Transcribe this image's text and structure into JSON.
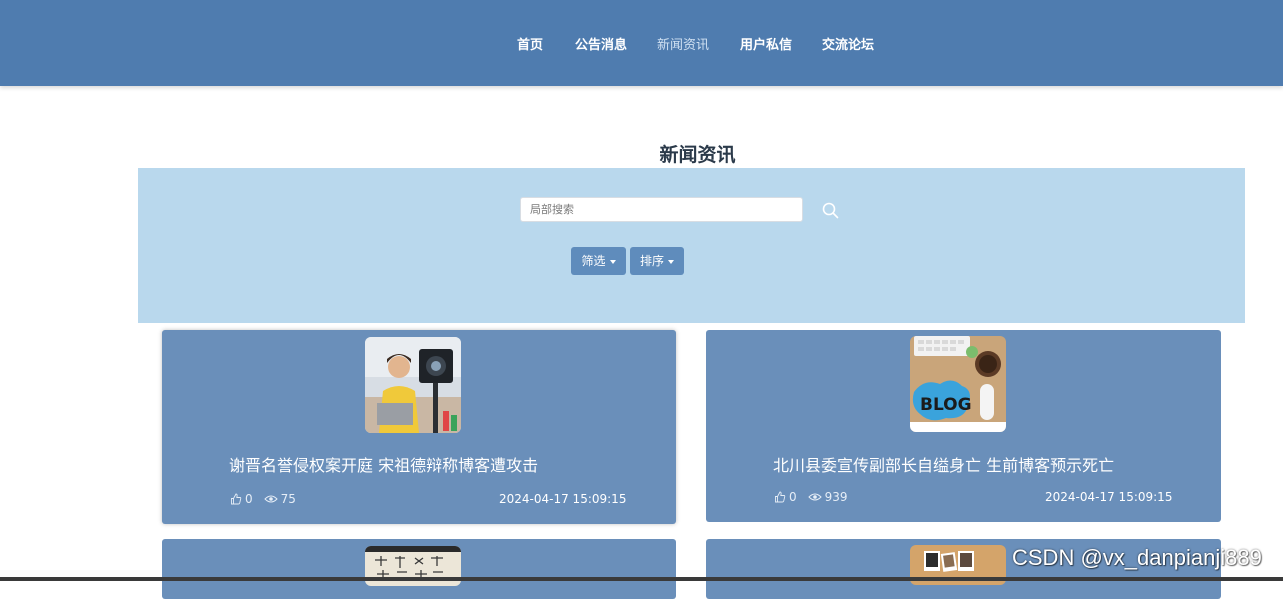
{
  "nav": {
    "items": [
      {
        "label": "首页"
      },
      {
        "label": "公告消息"
      },
      {
        "label": "新闻资讯"
      },
      {
        "label": "用户私信"
      },
      {
        "label": "交流论坛"
      }
    ],
    "active_index": 2
  },
  "page": {
    "title": "新闻资讯"
  },
  "search": {
    "placeholder": "局部搜索",
    "icon": "search-icon"
  },
  "filters": {
    "filter_label": "筛选",
    "sort_label": "排序"
  },
  "news": [
    {
      "title": "谢晋名誉侵权案开庭 宋祖德辩称博客遭攻击",
      "likes": "0",
      "views": "75",
      "date": "2024-04-17 15:09:15"
    },
    {
      "title": "北川县委宣传副部长自缢身亡 生前博客预示死亡",
      "likes": "0",
      "views": "939",
      "date": "2024-04-17 15:09:15"
    }
  ],
  "colors": {
    "header": "#4f7caf",
    "panel": "#b9d8ed",
    "card": "#6a8fba",
    "button": "#5f8cbc"
  },
  "watermark": "CSDN @vx_danpianji889"
}
